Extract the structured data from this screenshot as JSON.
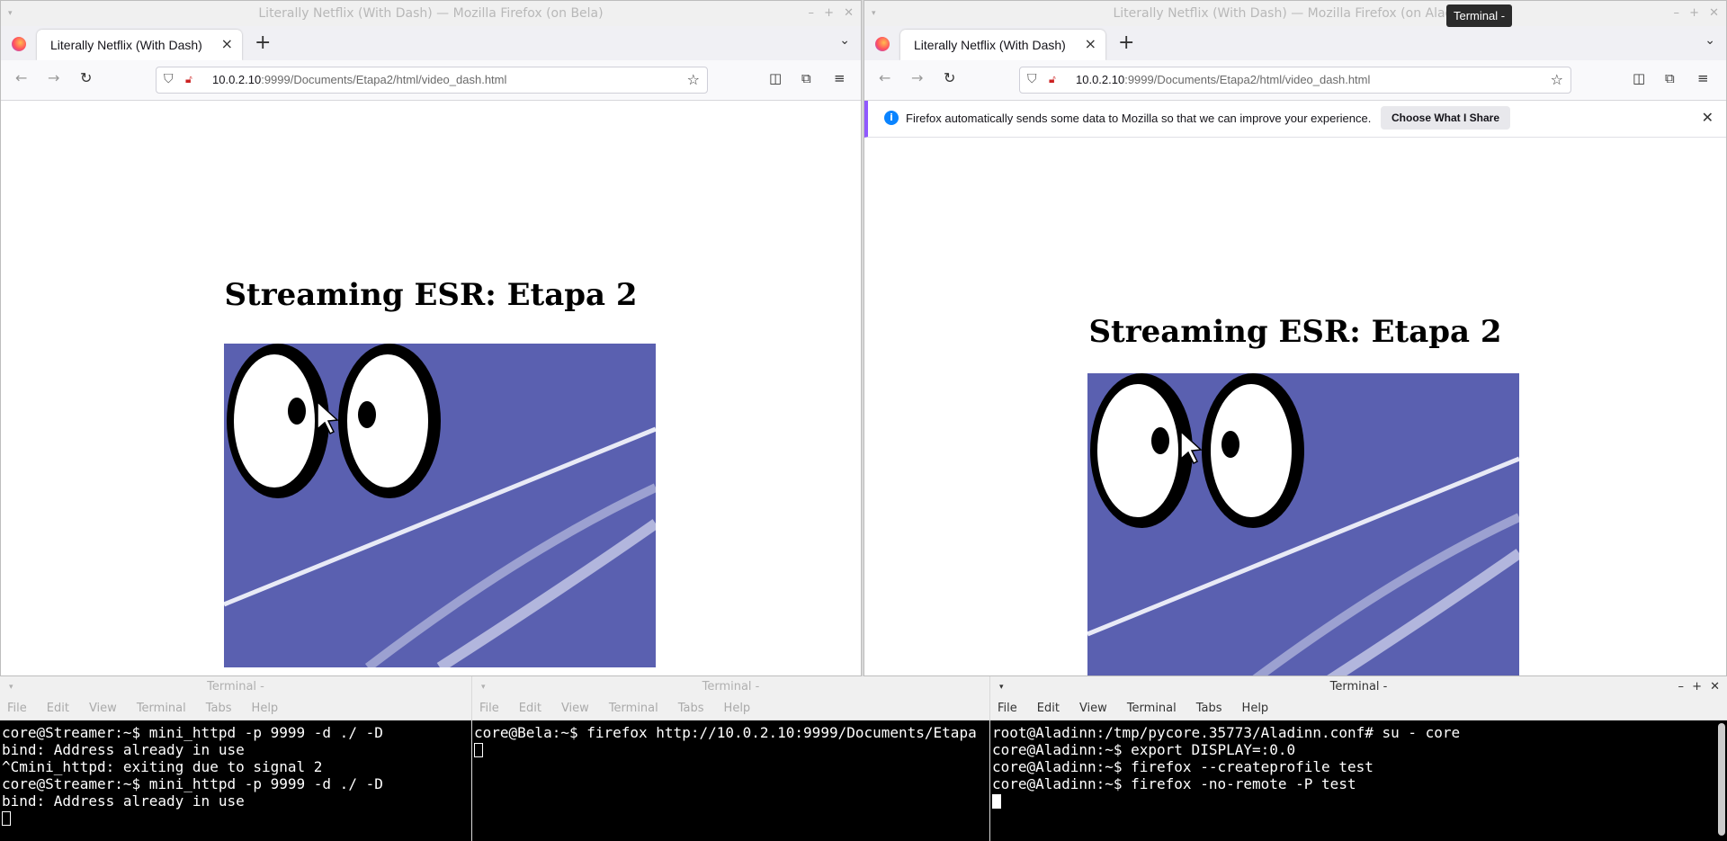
{
  "left_browser": {
    "window_title": "Literally Netflix (With Dash) — Mozilla Firefox (on Bela)",
    "tab_title": "Literally Netflix (With Dash)",
    "url_host": "10.0.2.10",
    "url_rest": ":9999/Documents/Etapa2/html/video_dash.html",
    "heading": "Streaming ESR: Etapa 2"
  },
  "right_browser": {
    "window_title": "Literally Netflix (With Dash) — Mozilla Firefox (on Aladinn)",
    "tab_title": "Literally Netflix (With Dash)",
    "url_host": "10.0.2.10",
    "url_rest": ":9999/Documents/Etapa2/html/video_dash.html",
    "notification_text": "Firefox automatically sends some data to Mozilla so that we can improve your experience.",
    "notification_button": "Choose What I Share",
    "heading": "Streaming ESR: Etapa 2"
  },
  "tooltip": "Terminal -",
  "terminal_menu": [
    "File",
    "Edit",
    "View",
    "Terminal",
    "Tabs",
    "Help"
  ],
  "terminals": [
    {
      "title": "Terminal -",
      "lines": [
        "core@Streamer:~$ mini_httpd -p 9999 -d ./ -D",
        "bind: Address already in use",
        "^Cmini_httpd: exiting due to signal 2",
        "core@Streamer:~$ mini_httpd -p 9999 -d ./ -D",
        "bind: Address already in use"
      ]
    },
    {
      "title": "Terminal -",
      "lines": [
        "core@Bela:~$ firefox http://10.0.2.10:9999/Documents/Etapa"
      ]
    },
    {
      "title": "Terminal -",
      "lines": [
        "root@Aladinn:/tmp/pycore.35773/Aladinn.conf# su - core",
        "core@Aladinn:~$ export DISPLAY=:0.0",
        "core@Aladinn:~$ firefox --createprofile test",
        "core@Aladinn:~$ firefox -no-remote -P test"
      ]
    }
  ]
}
